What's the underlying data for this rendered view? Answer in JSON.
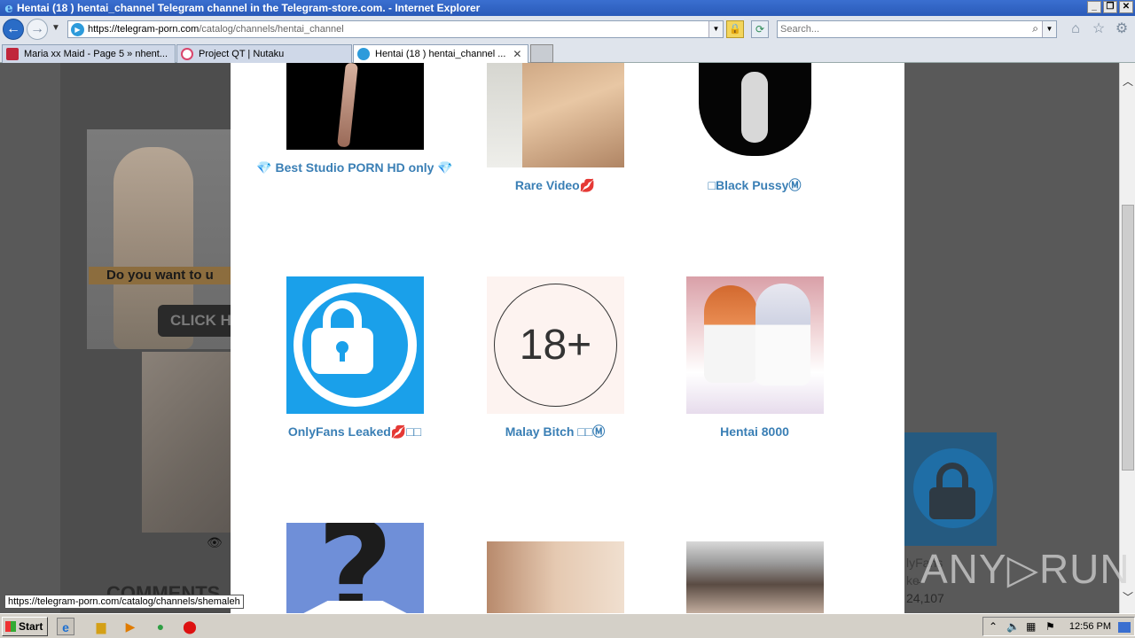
{
  "window": {
    "title": "Hentai (18 ) hentai_channel Telegram channel in the Telegram-store.com. - Internet Explorer",
    "ie_glyph": "e"
  },
  "address": {
    "url_host": "https://telegram-porn.com",
    "url_path": "/catalog/channels/hentai_channel"
  },
  "search": {
    "placeholder": "Search..."
  },
  "tabs": [
    {
      "label": "Maria xx Maid - Page 5 » nhent...",
      "icon": "nhentai-favicon",
      "color": "#c0263b",
      "active": false
    },
    {
      "label": "Project QT | Nutaku",
      "icon": "nutaku-favicon",
      "color": "#d9456b",
      "active": false
    },
    {
      "label": "Hentai (18 ) hentai_channel ...",
      "icon": "telegram-store-favicon",
      "color": "#2d9bdb",
      "active": true
    }
  ],
  "background": {
    "ad_question": "Do you want to u",
    "ad_button": "CLICK H",
    "comments_heading": "COMMENTS",
    "right_channel_name_1": "lyFans",
    "right_channel_name_2": "ke̵̵̵",
    "right_channel_views": "24,107"
  },
  "channels": [
    {
      "name": "💎 Best Studio PORN HD only 💎",
      "thumb": "dark-figure"
    },
    {
      "name": "Rare Video💋",
      "thumb": "skin-photo"
    },
    {
      "name": "□Black PussyⓂ",
      "thumb": "black-silhouette"
    },
    {
      "name": "OnlyFans Leaked💋□□",
      "thumb": "lock-logo"
    },
    {
      "name": "Malay Bitch □□Ⓜ",
      "thumb": "18-plus"
    },
    {
      "name": "Hentai 8000",
      "thumb": "anime-girls"
    },
    {
      "name": "",
      "thumb": "question-mark"
    },
    {
      "name": "",
      "thumb": "kiss-photo"
    },
    {
      "name": "",
      "thumb": "pool-photo"
    }
  ],
  "thumb_18_text": "18+",
  "status_url": "https://telegram-porn.com/catalog/channels/shemaleh",
  "watermark": "ANY▷RUN",
  "taskbar": {
    "start_label": "Start",
    "clock": "12:56 PM"
  }
}
